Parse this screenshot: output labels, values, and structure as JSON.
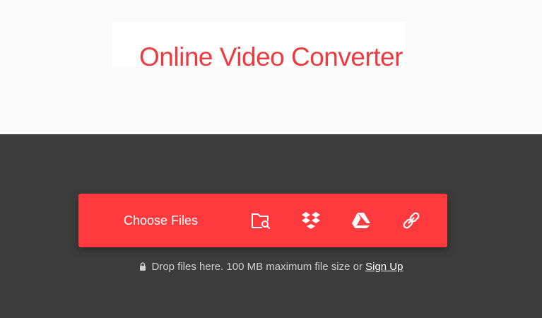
{
  "header": {
    "title": "Online Video Converter"
  },
  "upload": {
    "choose_label": "Choose Files",
    "sources": [
      {
        "icon": "folder-search-icon"
      },
      {
        "icon": "dropbox-icon"
      },
      {
        "icon": "google-drive-icon"
      },
      {
        "icon": "link-icon"
      }
    ],
    "hint_text": "Drop files here. 100 MB maximum file size or",
    "signup_label": "Sign Up"
  },
  "colors": {
    "accent": "#ff3a3e",
    "title": "#ef3b3f",
    "dark_bg": "#3c3c3c",
    "light_bg": "#fafafa"
  }
}
